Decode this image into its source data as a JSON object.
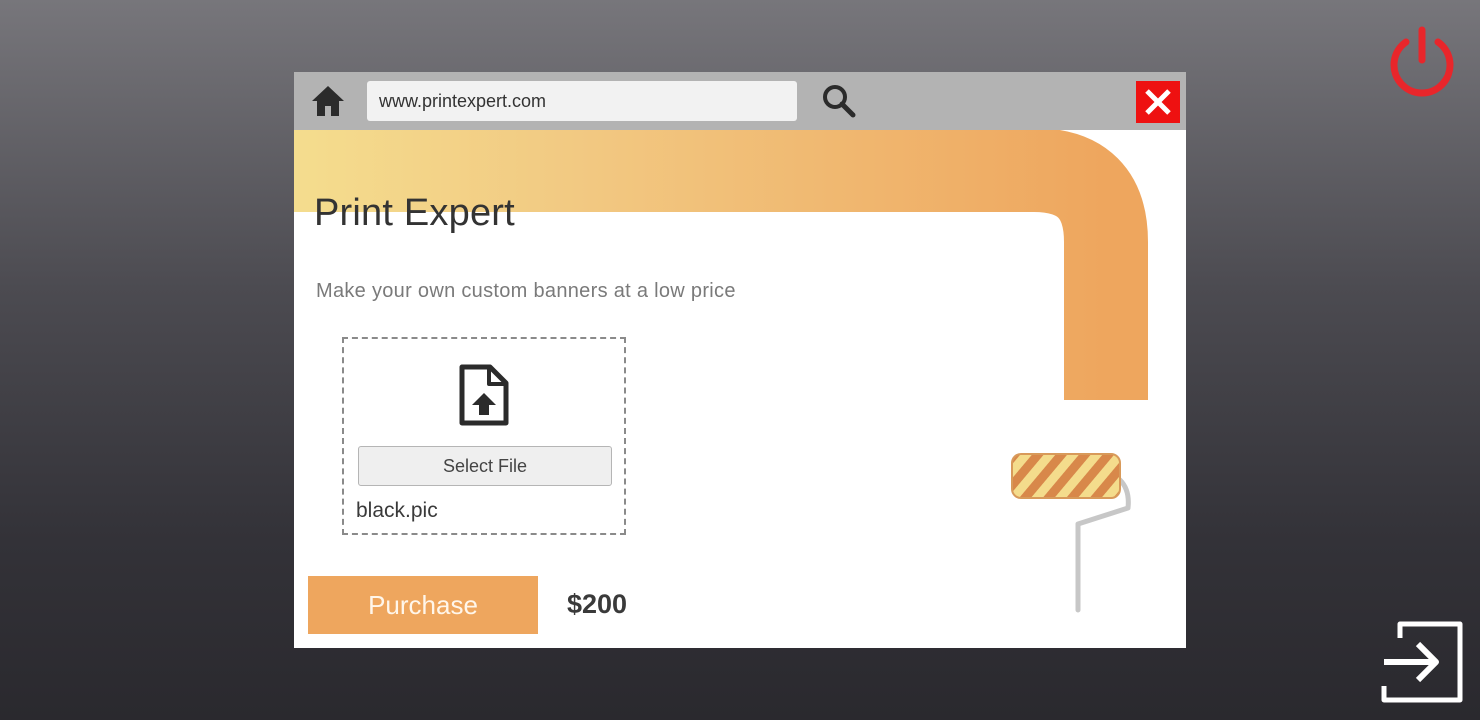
{
  "browser": {
    "url": "www.printexpert.com"
  },
  "site": {
    "title": "Print Expert",
    "tagline": "Make your own custom banners at a low price"
  },
  "upload": {
    "button_label": "Select File",
    "file_name": "black.pic"
  },
  "purchase": {
    "button_label": "Purchase",
    "price": "$200"
  },
  "icons": {
    "power": "power-icon",
    "exit": "exit-icon",
    "home": "home-icon",
    "search": "search-icon",
    "close": "close-icon",
    "file_upload": "file-upload-icon"
  },
  "colors": {
    "accent_orange": "#eea65e",
    "banner_yellow": "#f4dc8c",
    "close_red": "#ee1111",
    "power_red": "#e8262b",
    "browser_bar": "#b3b3b3"
  }
}
